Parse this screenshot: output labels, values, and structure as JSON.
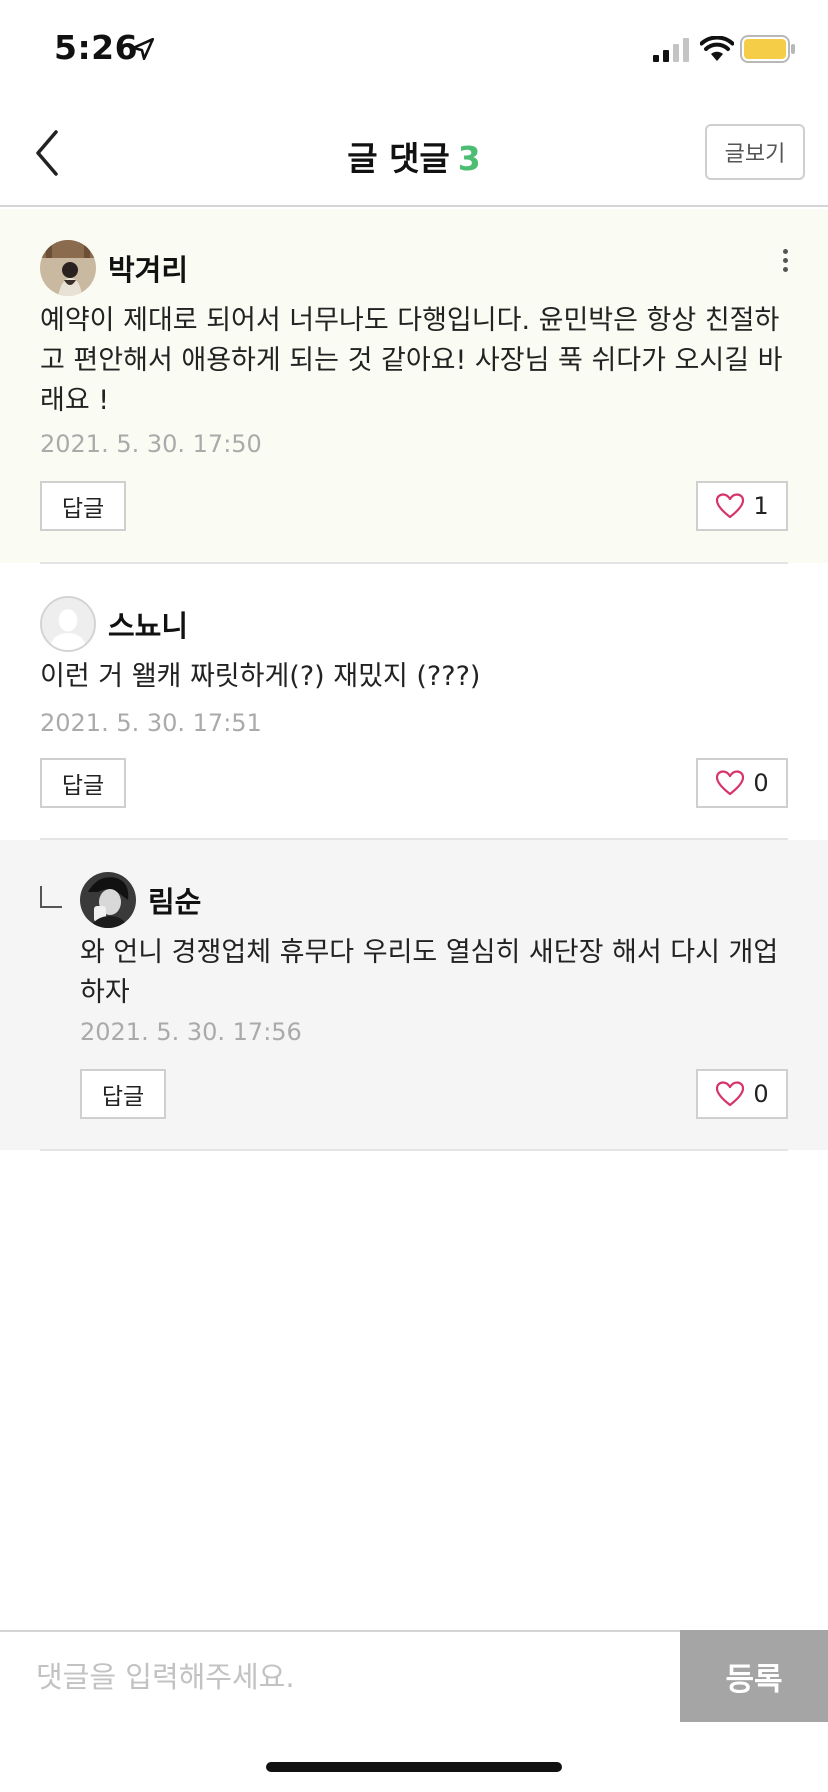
{
  "status_bar": {
    "time": "5:26",
    "icons": [
      "location-arrow-icon",
      "signal-icon",
      "wifi-icon",
      "battery-icon"
    ],
    "battery_color": "#f5cd47"
  },
  "header": {
    "title": "글 댓글",
    "count": "3",
    "count_color": "#4dbd74",
    "view_post_label": "글보기"
  },
  "comments": [
    {
      "author": "박겨리",
      "text": "예약이 제대로 되어서 너무나도 다행입니다. 윤민박은 항상 친절하고 편안해서 애용하게 되는 것 같아요! 사장님 푹 쉬다가 오시길 바래요 !",
      "timestamp": "2021. 5. 30. 17:50",
      "reply_label": "답글",
      "likes": "1"
    },
    {
      "author": "스뇨니",
      "text": "이런 거 왤캐 짜릿하게(?) 재밌지 (???)",
      "timestamp": "2021. 5. 30. 17:51",
      "reply_label": "답글",
      "likes": "0"
    },
    {
      "author": "림순",
      "text": "와 언니 경쟁업체 휴무다 우리도 열심히 새단장 해서 다시 개업하자",
      "timestamp": "2021. 5. 30. 17:56",
      "reply_label": "답글",
      "likes": "0"
    }
  ],
  "input": {
    "placeholder": "댓글을 입력해주세요.",
    "value": "",
    "submit_label": "등록"
  },
  "colors": {
    "highlight_bg": "#fafcf4",
    "reply_bg": "#f5f5f5",
    "heart": "#d6336c",
    "submit_bg": "#a5a5a5"
  }
}
